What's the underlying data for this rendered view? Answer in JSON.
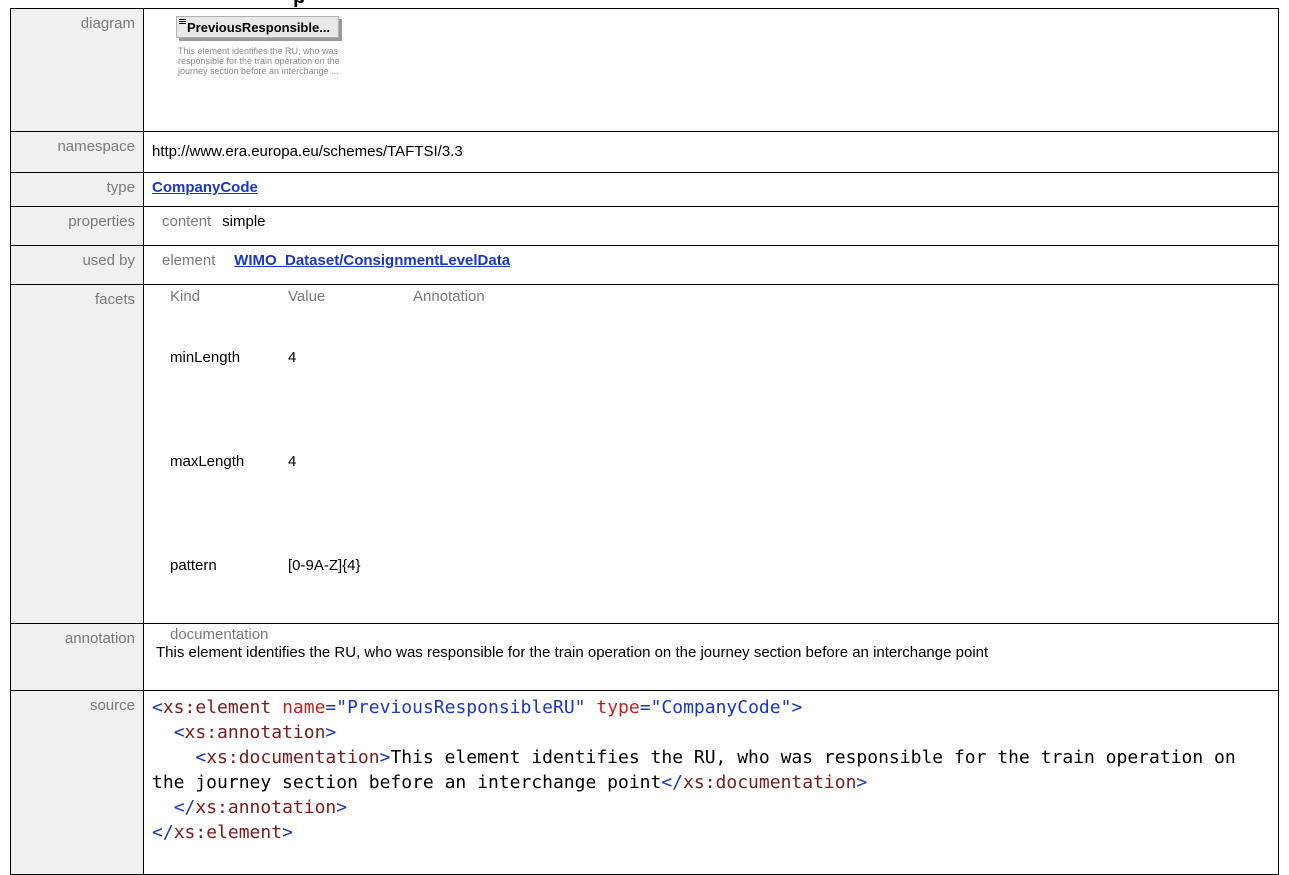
{
  "page": {
    "heading_partial": "p"
  },
  "labels": {
    "diagram": "diagram",
    "namespace": "namespace",
    "type": "type",
    "properties": "properties",
    "used_by": "used by",
    "facets": "facets",
    "annotation": "annotation",
    "source": "source"
  },
  "diagram": {
    "element_name": "PreviousResponsible...",
    "description": "This element identifies the RU, who was responsible for the train operation on the journey section before an interchange ..."
  },
  "namespace": "http://www.era.europa.eu/schemes/TAFTSI/3.3",
  "type": {
    "link_text": "CompanyCode"
  },
  "properties": {
    "key": "content",
    "value": "simple"
  },
  "used_by": {
    "key": "element",
    "link_text": "WIMO_Dataset/ConsignmentLevelData"
  },
  "facets": {
    "headers": [
      "Kind",
      "Value",
      "Annotation"
    ],
    "rows": [
      {
        "kind": "minLength",
        "value": "4",
        "annotation": ""
      },
      {
        "kind": "maxLength",
        "value": "4",
        "annotation": ""
      },
      {
        "kind": "pattern",
        "value": "[0-9A-Z]{4}",
        "annotation": ""
      }
    ]
  },
  "annotation": {
    "key": "documentation",
    "text": "This element identifies the RU, who was responsible for the train operation on the journey section before an interchange point"
  },
  "source": {
    "element_tag": "xs:element",
    "attr_name_1": "name",
    "attr_value_1": "\"PreviousResponsibleRU\"",
    "attr_name_2": "type",
    "attr_value_2": "\"CompanyCode\"",
    "annotation_tag": "xs:annotation",
    "documentation_tag": "xs:documentation",
    "documentation_text": "This element identifies the RU, who was responsible for the train operation on the journey section before an interchange point"
  }
}
